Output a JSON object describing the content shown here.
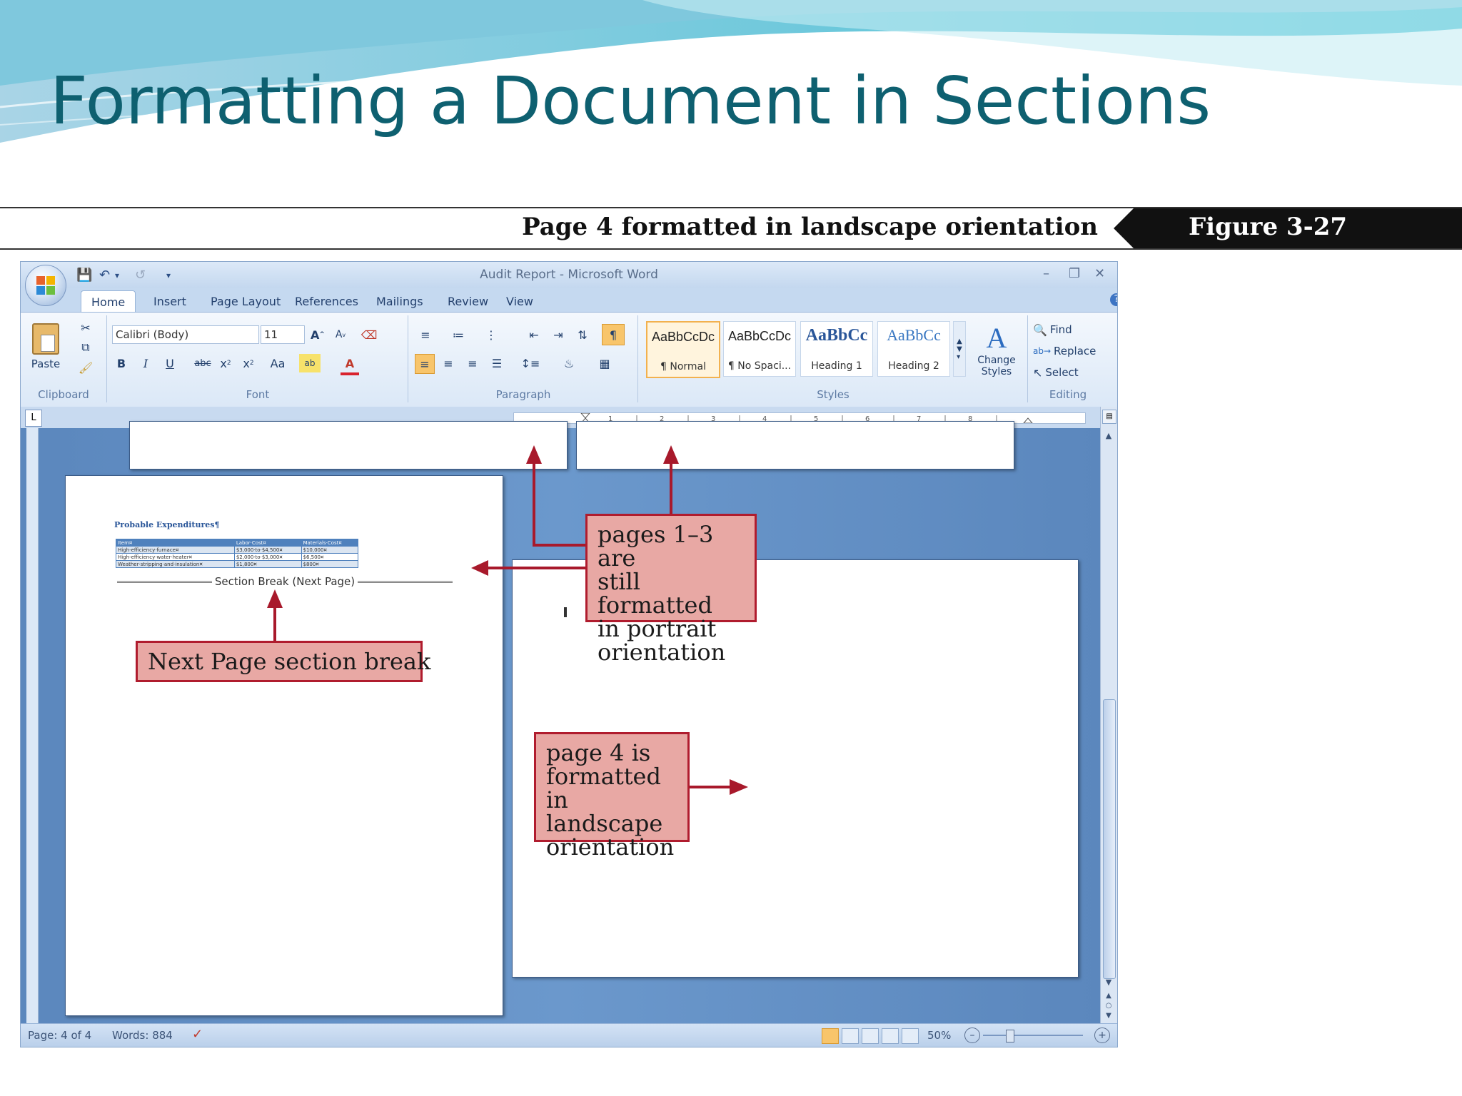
{
  "slide": {
    "title": "Formatting a Document in Sections",
    "caption": "Page 4 formatted in landscape orientation",
    "figure_label": "Figure  3-27"
  },
  "word": {
    "window_title": "Audit Report - Microsoft Word",
    "tabs": [
      "Home",
      "Insert",
      "Page Layout",
      "References",
      "Mailings",
      "Review",
      "View"
    ],
    "active_tab": "Home",
    "clipboard": {
      "paste_label": "Paste",
      "group_label": "Clipboard"
    },
    "font": {
      "name": "Calibri (Body)",
      "size": "11",
      "group_label": "Font"
    },
    "paragraph": {
      "group_label": "Paragraph"
    },
    "styles": {
      "group_label": "Styles",
      "items": [
        {
          "sample": "AaBbCcDc",
          "name": "¶ Normal"
        },
        {
          "sample": "AaBbCcDc",
          "name": "¶ No Spaci..."
        },
        {
          "sample": "AaBbCc",
          "name": "Heading 1"
        },
        {
          "sample": "AaBbCc",
          "name": "Heading 2"
        }
      ],
      "change_styles_label": "Change Styles"
    },
    "editing": {
      "group_label": "Editing",
      "find": "Find",
      "replace": "Replace",
      "select": "Select"
    },
    "status": {
      "page": "Page: 4 of 4",
      "words": "Words: 884",
      "zoom": "50%"
    }
  },
  "document": {
    "heading": "Probable Expenditures¶",
    "table": {
      "headers": [
        "Item¤",
        "Labor·Cost¤",
        "Materials·Cost¤"
      ],
      "rows": [
        [
          "High-efficiency·furnace¤",
          "$3,000·to·$4,500¤",
          "$10,000¤"
        ],
        [
          "High-efficiency·water·heater¤",
          "$2,000·to·$3,000¤",
          "$6,500¤"
        ],
        [
          "Weather·stripping·and·insulation¤",
          "$1,800¤",
          "$800¤"
        ]
      ]
    },
    "section_break": "Section Break (Next Page)"
  },
  "callouts": {
    "portrait": [
      "pages 1–3 are",
      "still formatted",
      "in portrait",
      "orientation"
    ],
    "next_page": "Next Page section break",
    "landscape": [
      "page 4 is",
      "formatted in",
      "landscape",
      "orientation"
    ]
  }
}
